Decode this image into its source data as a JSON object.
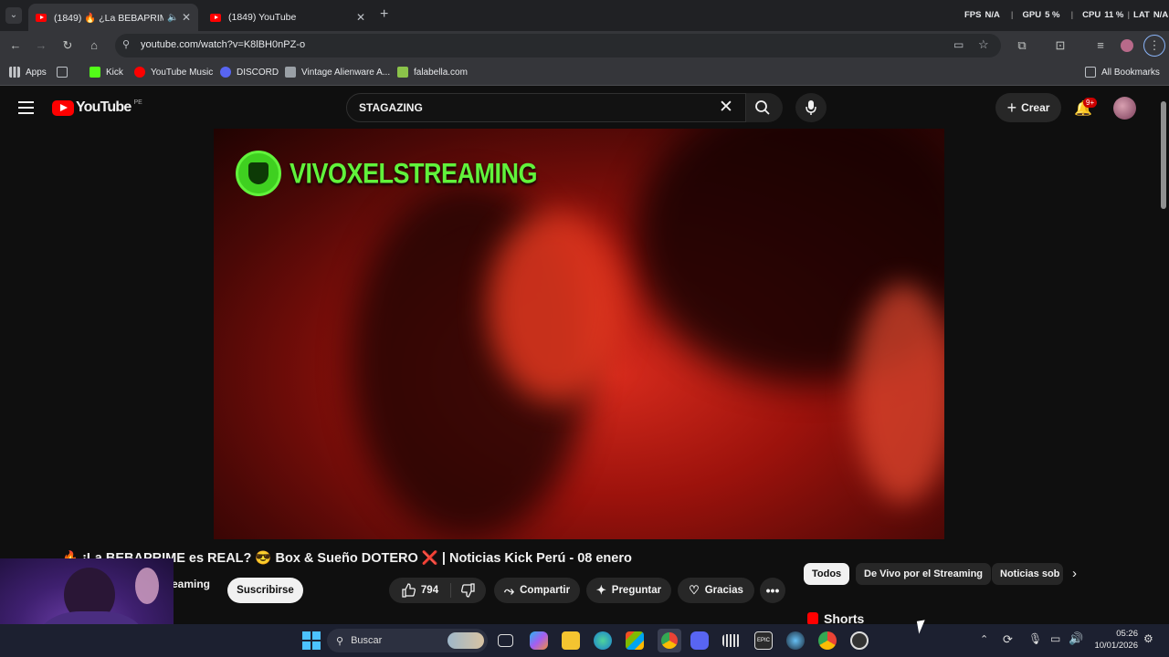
{
  "tabs": [
    {
      "label": "(1849) 🔥 ¿La BEBAPRIME",
      "active": true
    },
    {
      "label": "(1849) YouTube",
      "active": false
    }
  ],
  "overlay_stats": {
    "fps_label": "FPS",
    "fps": "N/A",
    "gpu_label": "GPU",
    "gpu": "5 %",
    "cpu_label": "CPU",
    "cpu": "11 %",
    "lat_label": "LAT",
    "lat": "N/A"
  },
  "address": {
    "url": "youtube.com/watch?v=K8lBH0nPZ-o"
  },
  "bookmarks": [
    {
      "label": "Apps",
      "color": "#5f6368"
    },
    {
      "label": "Kick",
      "color": "#53fc18"
    },
    {
      "label": "YouTube Music",
      "color": "#ff0000"
    },
    {
      "label": "DISCORD",
      "color": "#5865f2"
    },
    {
      "label": "Vintage Alienware A...",
      "color": "#9aa0a6"
    },
    {
      "label": "falabella.com",
      "color": "#8bc34a"
    }
  ],
  "all_bookmarks": "All Bookmarks",
  "youtube": {
    "logo": "YouTube",
    "country": "PE",
    "search_value": "STAGAZING",
    "create_label": "Crear",
    "notif_count": "9+"
  },
  "video": {
    "channel_overlay": "VIVOXELSTREAMING",
    "title": "🔥 ¡La BEBAPRIME es REAL? 😎 Box & Sueño DOTERO ❌ | Noticias Kick Perú - 08 enero",
    "channel_fragment": "eaming",
    "subscribe_label": "Suscribirse",
    "likes": "794",
    "share_label": "Compartir",
    "ask_label": "Preguntar",
    "thanks_label": "Gracias"
  },
  "chips": [
    "Todos",
    "De Vivo por el Streaming",
    "Noticias sob"
  ],
  "shorts_label": "Shorts",
  "taskbar": {
    "search_placeholder": "Buscar",
    "time": "05:26",
    "date": "10/01/2026"
  }
}
